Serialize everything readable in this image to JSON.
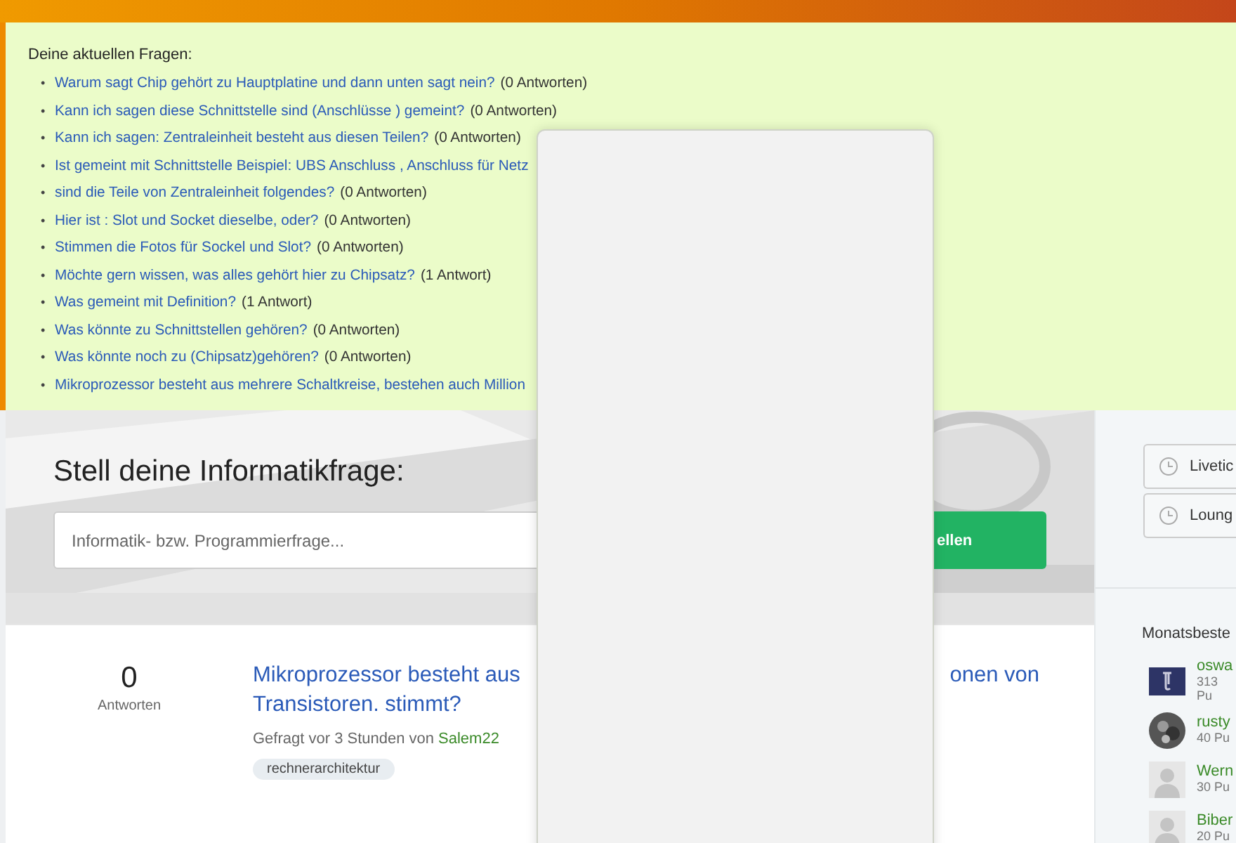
{
  "notice": {
    "heading": "Deine aktuellen Fragen:",
    "bullet": "•",
    "questions": [
      {
        "title": "Warum sagt Chip gehört zu Hauptplatine und dann unten sagt nein?",
        "answers": "(0 Antworten)"
      },
      {
        "title": "Kann ich sagen diese Schnittstelle sind (Anschlüsse ) gemeint?",
        "answers": "(0 Antworten)"
      },
      {
        "title": "Kann ich sagen: Zentraleinheit besteht aus diesen Teilen?",
        "answers": "(0 Antworten)"
      },
      {
        "title": "Ist gemeint mit Schnittstelle Beispiel: UBS Anschluss , Anschluss für Netz"
      },
      {
        "title": "sind die Teile von Zentraleinheit folgendes?",
        "answers": "(0 Antworten)"
      },
      {
        "title": "Hier ist : Slot und Socket dieselbe, oder?",
        "answers": "(0 Antworten)"
      },
      {
        "title": "Stimmen die Fotos für Sockel und Slot?",
        "answers": "(0 Antworten)"
      },
      {
        "title": "Möchte gern wissen, was alles gehört hier zu Chipsatz?",
        "answers": "(1 Antwort)"
      },
      {
        "title": "Was gemeint mit Definition?",
        "answers": "(1 Antwort)"
      },
      {
        "title": "Was könnte zu Schnittstellen gehören?",
        "answers": "(0 Antworten)"
      },
      {
        "title": "Was könnte noch zu (Chipsatz)gehören?",
        "answers": "(0 Antworten)"
      },
      {
        "title": "Mikroprozessor besteht aus mehrere Schaltkreise, bestehen auch Million"
      }
    ]
  },
  "hero": {
    "title": "Stell deine Informatikfrage:",
    "placeholder": "Informatik- bzw. Programmierfrage...",
    "button": "ellen"
  },
  "question": {
    "count": "0",
    "count_label": "Antworten",
    "title_left": "Mikroprozessor besteht aus",
    "title_right": "onen von",
    "title_line2": "Transistoren. stimmt?",
    "meta": "Gefragt vor 3 Stunden von",
    "author": "Salem22",
    "tags": [
      "rechnerarchitektur"
    ]
  },
  "sidebar": {
    "buttons": [
      "Livetic",
      "Loung"
    ],
    "heading": "Monatsbeste",
    "users": [
      {
        "name": "oswa",
        "points": "313 Pu",
        "kind": "logo"
      },
      {
        "name": "rusty",
        "points": "40 Pu"
      },
      {
        "name": "Wern",
        "points": "30 Pu",
        "kind": "default"
      },
      {
        "name": "Biber",
        "points": "20 Pu",
        "kind": "default"
      }
    ]
  }
}
